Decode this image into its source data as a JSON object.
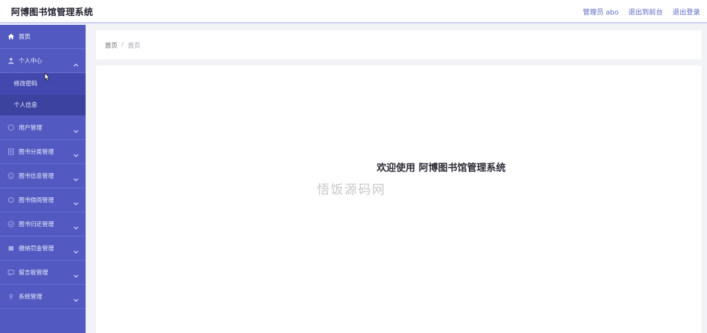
{
  "header": {
    "app_title": "阿博图书馆管理系统",
    "user_role": "管理员 abo",
    "front_link": "退出到前台",
    "logout_link": "退出登录"
  },
  "sidebar": {
    "home": {
      "label": "首页",
      "icon": "home-icon"
    },
    "personal_center": {
      "label": "个人中心",
      "icon": "user-icon",
      "expanded": true,
      "children": [
        {
          "label": "修改密码"
        },
        {
          "label": "个人信息"
        }
      ]
    },
    "items": [
      {
        "label": "用户管理",
        "icon": "users-icon"
      },
      {
        "label": "图书分类管理",
        "icon": "category-icon"
      },
      {
        "label": "图书信息管理",
        "icon": "info-icon"
      },
      {
        "label": "图书借阅管理",
        "icon": "borrow-icon"
      },
      {
        "label": "图书归还管理",
        "icon": "return-icon"
      },
      {
        "label": "缴纳罚金管理",
        "icon": "fine-icon"
      },
      {
        "label": "留言板管理",
        "icon": "message-icon"
      },
      {
        "label": "系统管理",
        "icon": "settings-icon"
      }
    ]
  },
  "breadcrumb": {
    "home": "首页",
    "separator": "/",
    "current": "首页"
  },
  "main": {
    "welcome_text": "欢迎使用 阿博图书馆管理系统",
    "watermark": "悟饭源码网"
  },
  "colors": {
    "sidebar_bg": "#5259c0",
    "submenu_bg": "#4248ad",
    "accent": "#5c6ac4"
  }
}
